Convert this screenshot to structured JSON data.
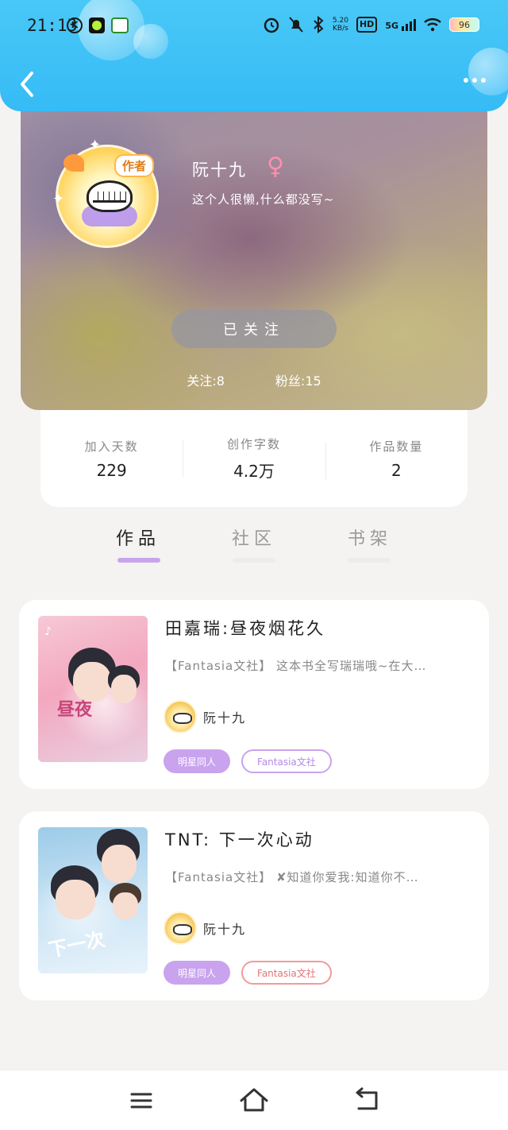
{
  "status_bar": {
    "time": "21:13",
    "net_speed_value": "5.20",
    "net_speed_unit": "KB/s",
    "hd": "HD",
    "signal": "5G",
    "battery": "96"
  },
  "profile": {
    "badge": "作者",
    "username": "阮十九",
    "gender_symbol": "♀",
    "bio": "这个人很懒,什么都没写~",
    "follow_button": "已关注",
    "following_label": "关注:",
    "following_count": "8",
    "fans_label": "粉丝:",
    "fans_count": "15"
  },
  "stats": [
    {
      "label": "加入天数",
      "value": "229"
    },
    {
      "label": "创作字数",
      "value": "4.2万"
    },
    {
      "label": "作品数量",
      "value": "2"
    }
  ],
  "tabs": [
    {
      "label": "作品",
      "active": true
    },
    {
      "label": "社区",
      "active": false
    },
    {
      "label": "书架",
      "active": false
    }
  ],
  "books": [
    {
      "title": "田嘉瑞:昼夜烟花久",
      "description": "【Fantasia文社】 这本书全写瑞瑞哦~在大…",
      "author": "阮十九",
      "tags": [
        "明星同人",
        "Fantasia文社"
      ]
    },
    {
      "title": "TNT: 下一次心动",
      "description": "【Fantasia文社】 ✘知道你爱我:知道你不…",
      "author": "阮十九",
      "tags": [
        "明星同人",
        "Fantasia文社"
      ]
    }
  ]
}
